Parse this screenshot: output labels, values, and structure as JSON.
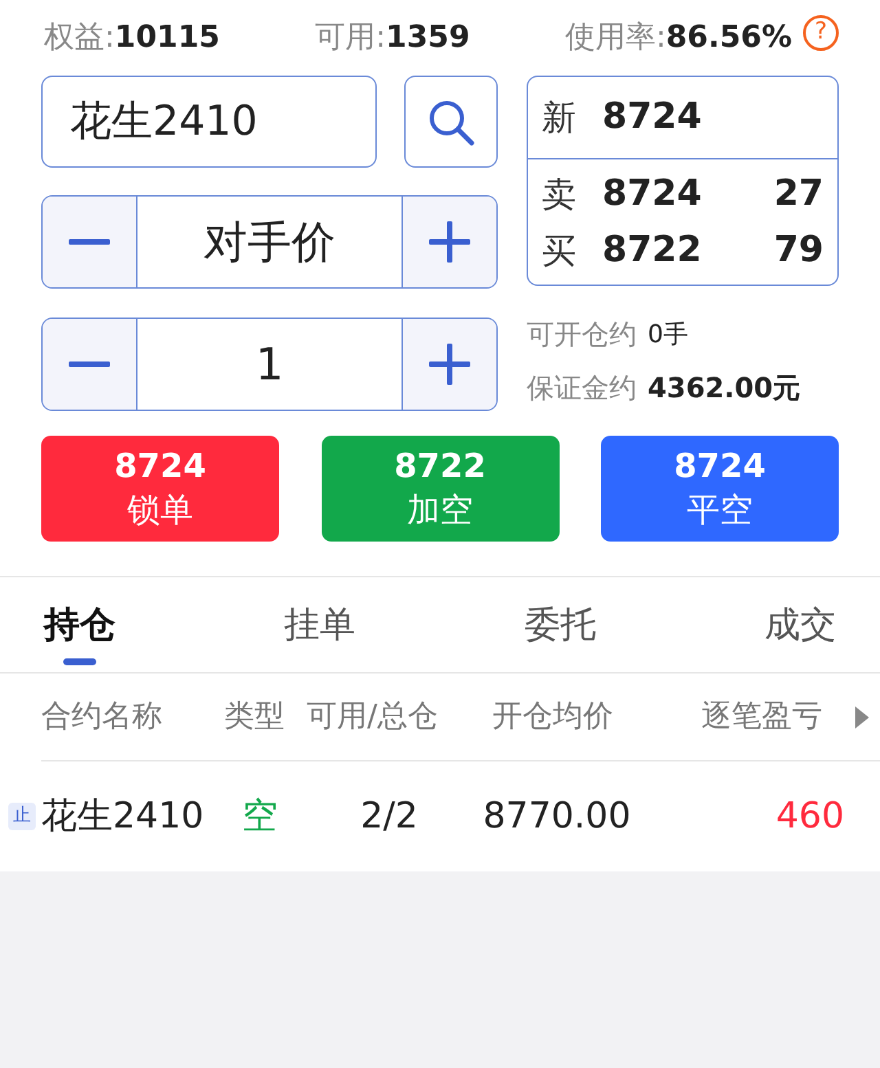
{
  "account": [
    {
      "label": "权益:",
      "value": "10115"
    },
    {
      "label": "可用:",
      "value": "1359"
    },
    {
      "label": "使用率:",
      "value": "86.56%"
    }
  ],
  "help": "?",
  "order": {
    "symbol": "花生2410",
    "price_type": "对手价",
    "quantity": "1"
  },
  "quote": {
    "last": {
      "label": "新",
      "price": "8724"
    },
    "ask": {
      "label": "卖",
      "price": "8724",
      "volume": "27"
    },
    "bid": {
      "label": "买",
      "price": "8722",
      "volume": "79"
    }
  },
  "info": [
    {
      "label": "可开仓约",
      "value": "0手"
    },
    {
      "label": "保证金约",
      "value": "4362.00元"
    }
  ],
  "actions": [
    {
      "price": "8724",
      "label": "锁单",
      "color": "#ff2a3d"
    },
    {
      "price": "8722",
      "label": "加空",
      "color": "#12a84b"
    },
    {
      "price": "8724",
      "label": "平空",
      "color": "#2f68ff"
    }
  ],
  "tabs": [
    {
      "label": "持仓",
      "selected": true
    },
    {
      "label": "挂单",
      "selected": false
    },
    {
      "label": "委托",
      "selected": false
    },
    {
      "label": "成交",
      "selected": false
    }
  ],
  "table": {
    "columns": [
      "合约名称",
      "类型",
      "可用/总仓",
      "开仓均价",
      "逐笔盈亏"
    ],
    "rows": [
      {
        "badge": "止",
        "name": "花生2410",
        "type": "空",
        "available": "2/2",
        "avg_price": "8770.00",
        "pnl": "460",
        "profit": true
      }
    ]
  }
}
